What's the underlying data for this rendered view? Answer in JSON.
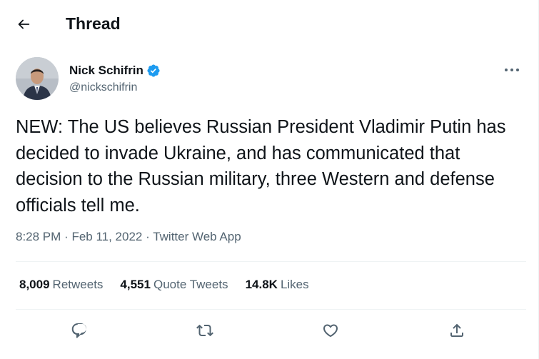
{
  "header": {
    "title": "Thread",
    "back_icon": "arrow-left-icon"
  },
  "author": {
    "name": "Nick Schifrin",
    "handle": "@nickschifrin",
    "verified_color": "#1d9bf0"
  },
  "tweet": {
    "text": "NEW: The US believes Russian President Vladimir Putin has decided to invade Ukraine, and has communicated that decision to the Russian military, three Western and defense officials tell me.",
    "time": "8:28 PM",
    "date": "Feb 11, 2022",
    "source": "Twitter Web App",
    "separator": "·"
  },
  "stats": {
    "retweets": {
      "count": "8,009",
      "label": "Retweets"
    },
    "quotes": {
      "count": "4,551",
      "label": "Quote Tweets"
    },
    "likes": {
      "count": "14.8K",
      "label": "Likes"
    }
  },
  "actions": [
    "reply-icon",
    "retweet-icon",
    "like-icon",
    "share-icon"
  ],
  "colors": {
    "text": "#0f1419",
    "secondary": "#536471",
    "border": "#eff3f4",
    "accent": "#1d9bf0"
  }
}
